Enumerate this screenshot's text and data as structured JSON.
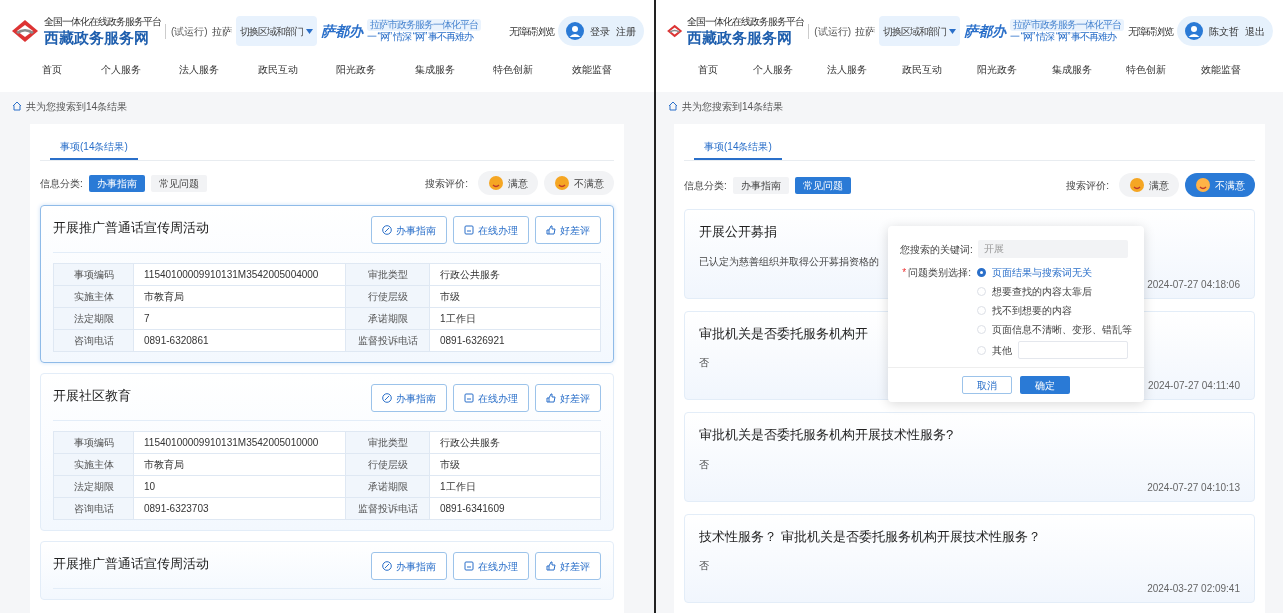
{
  "panels": [
    {
      "header": {
        "platform": "全国一体化在线政务服务平台",
        "site": "西藏政务服务网",
        "trial": "(试运行)",
        "city": "拉萨",
        "region_select": "切换区域和部门",
        "brand": "萨都办",
        "slogan": "拉萨市政务服务一体化平台",
        "motto": "一 “网” 情深  “网” 事不再难办",
        "accessibility": "无障碍浏览",
        "user_links": [
          "登录",
          "注册"
        ]
      },
      "nav": [
        "首页",
        "个人服务",
        "法人服务",
        "政民互动",
        "阳光政务",
        "集成服务",
        "特色创新",
        "效能监督"
      ],
      "breadcrumb": "共为您搜索到14条结果",
      "tab": {
        "label": "事项(14条结果)",
        "selected": true
      },
      "filter": {
        "label": "信息分类:",
        "options": [
          {
            "label": "办事指南",
            "selected": true
          },
          {
            "label": "常见问题",
            "selected": false
          }
        ]
      },
      "rating": {
        "label": "搜索评价:",
        "options": [
          {
            "label": "满意",
            "selected": false
          },
          {
            "label": "不满意",
            "selected": false
          }
        ]
      },
      "results": [
        {
          "kind": "item",
          "selected": true,
          "title": "开展推广普通话宣传周活动",
          "actions": [
            "办事指南",
            "在线办理",
            "好差评"
          ],
          "table": [
            [
              "事项编码",
              "11540100009910131M3542005004000",
              "审批类型",
              "行政公共服务"
            ],
            [
              "实施主体",
              "市教育局",
              "行使层级",
              "市级"
            ],
            [
              "法定期限",
              "7",
              "承诺期限",
              "1工作日"
            ],
            [
              "咨询电话",
              "0891-6320861",
              "监督投诉电话",
              "0891-6326921"
            ]
          ]
        },
        {
          "kind": "item",
          "selected": false,
          "title": "开展社区教育",
          "actions": [
            "办事指南",
            "在线办理",
            "好差评"
          ],
          "table": [
            [
              "事项编码",
              "11540100009910131M3542005010000",
              "审批类型",
              "行政公共服务"
            ],
            [
              "实施主体",
              "市教育局",
              "行使层级",
              "市级"
            ],
            [
              "法定期限",
              "10",
              "承诺期限",
              "1工作日"
            ],
            [
              "咨询电话",
              "0891-6323703",
              "监督投诉电话",
              "0891-6341609"
            ]
          ]
        },
        {
          "kind": "item",
          "selected": false,
          "title": "开展推广普通话宣传周活动",
          "actions": [
            "办事指南",
            "在线办理",
            "好差评"
          ]
        }
      ]
    },
    {
      "header": {
        "platform": "全国一体化在线政务服务平台",
        "site": "西藏政务服务网",
        "trial": "(试运行)",
        "city": "拉萨",
        "region_select": "切换区域和部门",
        "brand": "萨都办",
        "slogan": "拉萨市政务服务一体化平台",
        "motto": "一 “网” 情深  “网” 事不再难办",
        "accessibility": "无障碍浏览",
        "user_links": [
          "陈文哲",
          "退出"
        ]
      },
      "nav": [
        "首页",
        "个人服务",
        "法人服务",
        "政民互动",
        "阳光政务",
        "集成服务",
        "特色创新",
        "效能监督"
      ],
      "breadcrumb": "共为您搜索到14条结果",
      "tab": {
        "label": "事项(14条结果)",
        "selected": true
      },
      "filter": {
        "label": "信息分类:",
        "options": [
          {
            "label": "办事指南",
            "selected": false
          },
          {
            "label": "常见问题",
            "selected": true
          }
        ]
      },
      "rating": {
        "label": "搜索评价:",
        "options": [
          {
            "label": "满意",
            "selected": false
          },
          {
            "label": "不满意",
            "selected": true
          }
        ]
      },
      "results": [
        {
          "kind": "faq",
          "title": "开展公开募捐",
          "answer": "已认定为慈善组织并取得公开募捐资格的",
          "time": "2024-07-27 04:18:06"
        },
        {
          "kind": "faq",
          "title": "审批机关是否委托服务机构开",
          "answer": "否",
          "time": "2024-07-27 04:11:40"
        },
        {
          "kind": "faq",
          "title": "审批机关是否委托服务机构开展技术性服务?",
          "answer": "否",
          "time": "2024-07-27 04:10:13"
        },
        {
          "kind": "faq",
          "title": "技术性服务？ 审批机关是否委托服务机构开展技术性服务？",
          "answer": "否",
          "time": "2024-03-27 02:09:41"
        }
      ],
      "dialog": {
        "keyword_label": "您搜索的关键词:",
        "keyword_value": "开展",
        "required_mark": "*",
        "category_label": "问题类别选择:",
        "options": [
          {
            "kind": "option",
            "label": "页面结果与搜索词无关",
            "selected": true
          },
          {
            "kind": "option",
            "label": "想要查找的内容太靠后",
            "selected": false
          },
          {
            "kind": "option",
            "label": "找不到想要的内容",
            "selected": false
          },
          {
            "kind": "option",
            "label": "页面信息不清晰、变形、错乱等",
            "selected": false
          },
          {
            "kind": "other",
            "label": "其他",
            "selected": false
          }
        ],
        "buttons": [
          {
            "label": "取消",
            "kind": "secondary"
          },
          {
            "label": "确定",
            "kind": "primary"
          }
        ]
      }
    }
  ]
}
